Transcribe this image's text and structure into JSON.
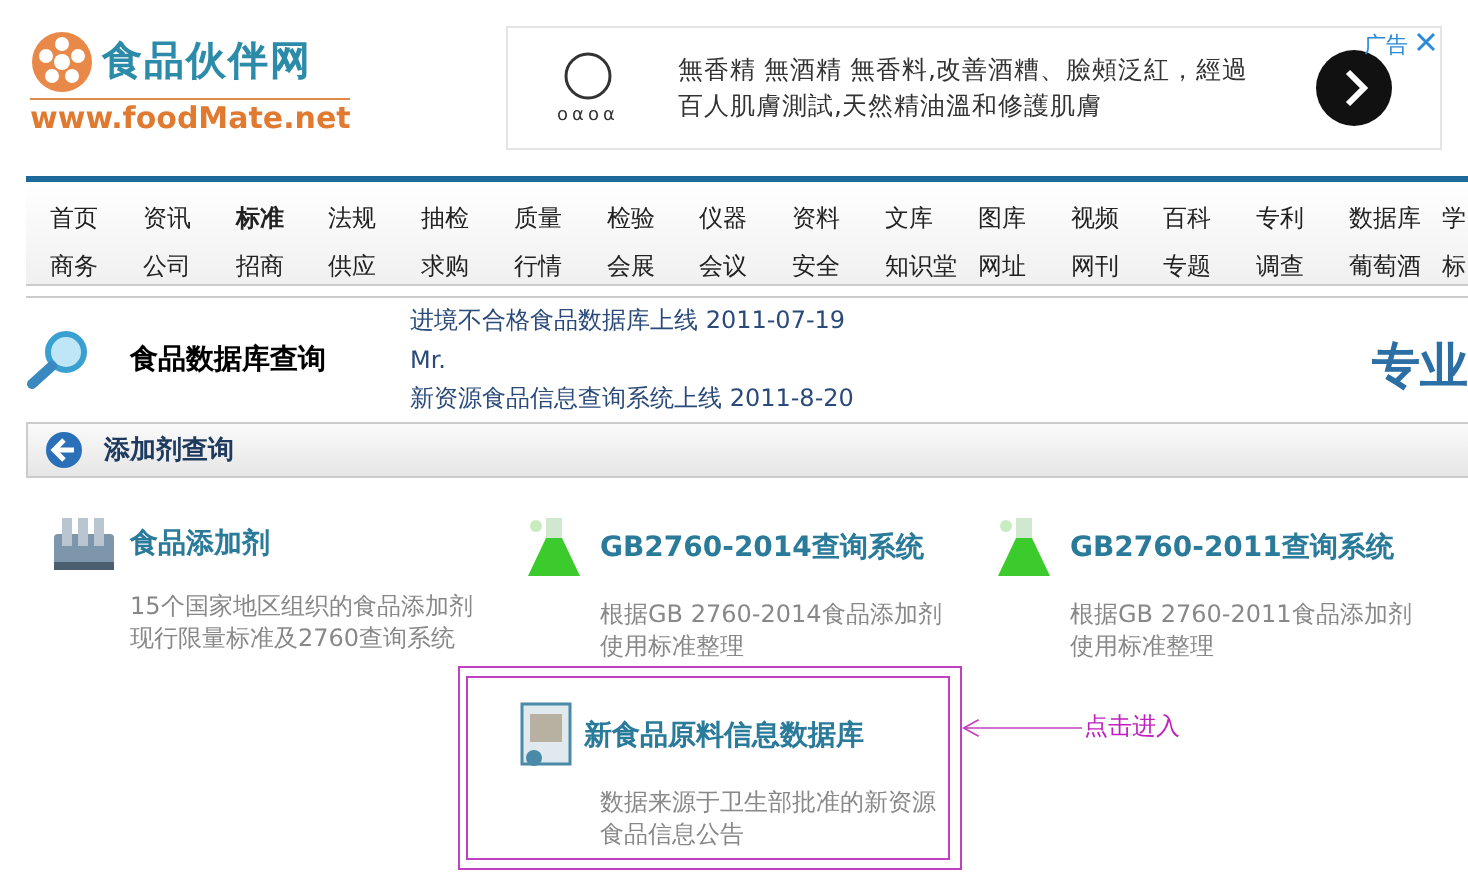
{
  "logo": {
    "name": "食品伙伴网",
    "url": "www.foodMate.net"
  },
  "ad": {
    "brand": "oαoα",
    "lines": [
      "無香精 無酒精 無香料,改善酒糟、臉頰泛紅，經過",
      "百人肌膚測試,天然精油溫和修護肌膚"
    ],
    "label": "广告"
  },
  "nav": [
    [
      {
        "label": "首页",
        "selected": false
      },
      {
        "label": "资讯",
        "selected": false
      },
      {
        "label": "标准",
        "selected": true
      },
      {
        "label": "法规",
        "selected": false
      },
      {
        "label": "抽检",
        "selected": false
      },
      {
        "label": "质量",
        "selected": false
      },
      {
        "label": "检验",
        "selected": false
      },
      {
        "label": "仪器",
        "selected": false
      },
      {
        "label": "资料",
        "selected": false
      },
      {
        "label": "文库",
        "selected": false
      },
      {
        "label": "图库",
        "selected": false
      },
      {
        "label": "视频",
        "selected": false
      },
      {
        "label": "百科",
        "selected": false
      },
      {
        "label": "专利",
        "selected": false
      },
      {
        "label": "数据库",
        "selected": false
      },
      {
        "label": "学",
        "selected": false
      }
    ],
    [
      {
        "label": "商务",
        "selected": false
      },
      {
        "label": "公司",
        "selected": false
      },
      {
        "label": "招商",
        "selected": false
      },
      {
        "label": "供应",
        "selected": false
      },
      {
        "label": "求购",
        "selected": false
      },
      {
        "label": "行情",
        "selected": false
      },
      {
        "label": "会展",
        "selected": false
      },
      {
        "label": "会议",
        "selected": false
      },
      {
        "label": "安全",
        "selected": false
      },
      {
        "label": "知识堂",
        "selected": false
      },
      {
        "label": "网址",
        "selected": false
      },
      {
        "label": "网刊",
        "selected": false
      },
      {
        "label": "专题",
        "selected": false
      },
      {
        "label": "调查",
        "selected": false
      },
      {
        "label": "葡萄酒",
        "selected": false
      },
      {
        "label": "标",
        "selected": false
      }
    ]
  ],
  "db_header": {
    "title": "食品数据库查询",
    "news": [
      "进境不合格食品数据库上线 2011-07-19",
      "Mr.",
      "新资源食品信息查询系统上线 2011-8-20"
    ],
    "slogan": "专业"
  },
  "section": {
    "title": "添加剂查询"
  },
  "items": [
    {
      "kind": "rack",
      "title": "食品添加剂",
      "description": "15个国家地区组织的食品添加剂现行限量标准及2760查询系统"
    },
    {
      "kind": "flask",
      "title": "GB2760-2014查询系统",
      "description": "根据GB 2760-2014食品添加剂使用标准整理"
    },
    {
      "kind": "flask",
      "title": "GB2760-2011查询系统",
      "description": "根据GB 2760-2011食品添加剂使用标准整理"
    },
    {
      "kind": "certificate",
      "title": "新食品原料信息数据库",
      "description": "数据来源于卫生部批准的新资源食品信息公告"
    }
  ],
  "annotation": {
    "label": "点击进入"
  }
}
